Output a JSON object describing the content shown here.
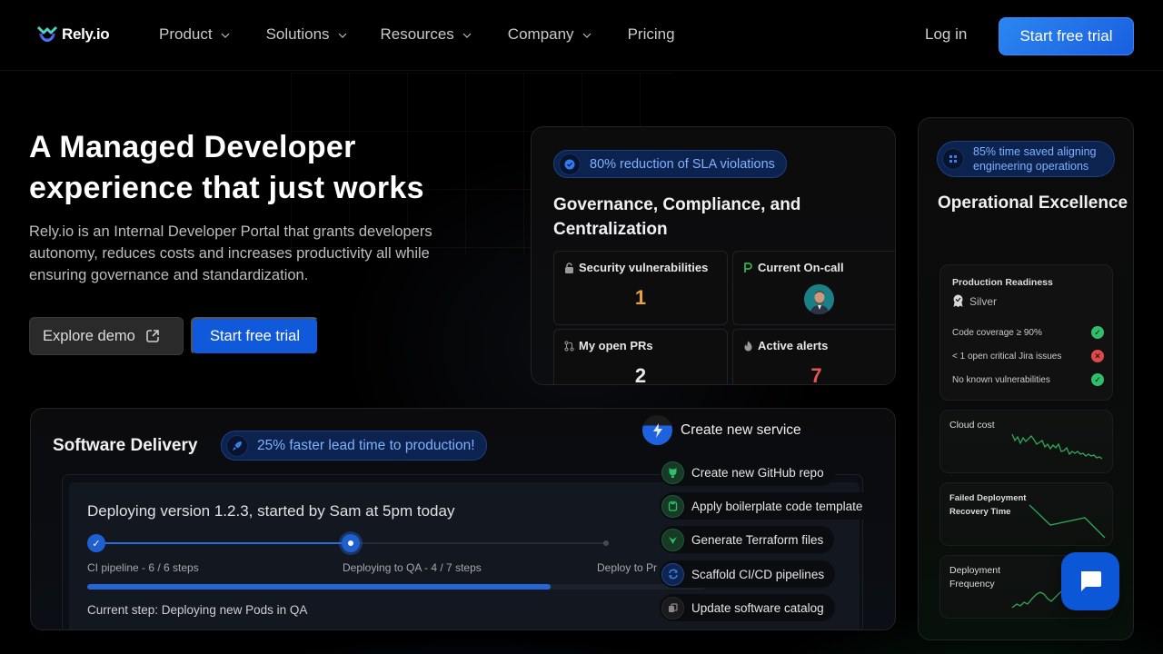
{
  "nav": {
    "logo_text": "Rely.io",
    "items": [
      {
        "label": "Product",
        "has_dropdown": true
      },
      {
        "label": "Solutions",
        "has_dropdown": true
      },
      {
        "label": "Resources",
        "has_dropdown": true
      },
      {
        "label": "Company",
        "has_dropdown": true
      },
      {
        "label": "Pricing",
        "has_dropdown": false
      }
    ],
    "login_label": "Log in",
    "cta_label": "Start free trial"
  },
  "hero": {
    "title": "A Managed Developer experience that just works",
    "subtitle": "Rely.io is an Internal Developer Portal that grants developers autonomy, reduces costs and increases productivity all while ensuring governance and standardization.",
    "explore_label": "Explore demo",
    "trial_label": "Start free trial"
  },
  "governance": {
    "badge": "80% reduction of SLA violations",
    "title": "Governance, Compliance, and Centralization",
    "tiles": [
      {
        "label": "Security vulnerabilities",
        "icon": "lock-icon",
        "value": "1",
        "value_color": "#e6a23c"
      },
      {
        "label": "Current On-call",
        "icon": "pagerduty-icon",
        "value": "",
        "avatar": true
      },
      {
        "label": "My open PRs",
        "icon": "pull-request-icon",
        "value": "2",
        "value_color": "#e8e8e8"
      },
      {
        "label": "Active alerts",
        "icon": "fire-icon",
        "value": "7",
        "value_color": "#e0584f"
      }
    ]
  },
  "operational": {
    "badge": "85% time saved aligning engineering operations",
    "title": "Operational Excellence",
    "readiness": {
      "title": "Production Readiness",
      "tier": "Silver",
      "checks": [
        {
          "label": "Code coverage ≥ 90%",
          "status": "pass"
        },
        {
          "label": "< 1 open critical Jira issues",
          "status": "fail"
        },
        {
          "label": "No known vulnerabilities",
          "status": "pass"
        }
      ]
    },
    "metrics": [
      {
        "label": "Cloud cost",
        "trend": "down"
      },
      {
        "label": "Failed Deployment Recovery Time",
        "trend": "down"
      },
      {
        "label": "Deployment Frequency",
        "trend": "up"
      }
    ]
  },
  "delivery": {
    "title": "Software Delivery",
    "badge": "25% faster lead time to production!",
    "deploy_title": "Deploying version 1.2.3, started by Sam at 5pm today",
    "steps": [
      {
        "label": "CI pipeline - 6 / 6 steps",
        "state": "done"
      },
      {
        "label": "Deploying to QA - 4 / 7 steps",
        "state": "active"
      },
      {
        "label": "Deploy to Pr",
        "state": "pending"
      }
    ],
    "progress_percent": 75,
    "current_step": "Current step: Deploying new Pods in QA"
  },
  "create_service": {
    "title": "Create new service",
    "actions": [
      {
        "label": "Create new GitHub repo",
        "icon": "github-icon"
      },
      {
        "label": "Apply boilerplate code template",
        "icon": "template-icon"
      },
      {
        "label": "Generate Terraform files",
        "icon": "terraform-icon"
      },
      {
        "label": "Scaffold CI/CD pipelines",
        "icon": "pipeline-icon"
      },
      {
        "label": "Update software catalog",
        "icon": "catalog-icon"
      }
    ]
  },
  "colors": {
    "accent": "#1a5fe0",
    "pass": "#2fbf6a",
    "fail": "#e0484a",
    "chart_line": "#2fa75a"
  }
}
